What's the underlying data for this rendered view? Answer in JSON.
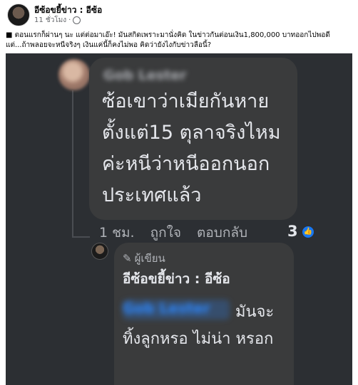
{
  "post": {
    "author": "อีซ้อขยี้ข่าว : อีซ้อ",
    "time": "11 ชั่วโมง",
    "audience_icon": "globe-icon",
    "text_line1": "■ ตอนแรกก็ผ่านๆ นะ แต่ต่อมาเอ๊ะ! มันสกิดเพราะมานั่งคิด ในข่าวกันต่อนเงิน1,800,000 บาทออกไปพอดี",
    "text_line2": "แต่...ถ้าพลอยจะหนีจริงๆ เงินแค่นี้ก็คงไม่พอ คิดว่ายังไงกับข่าวลือนี้?"
  },
  "screenshot": {
    "comment": {
      "author_blurred": "Gob Lester",
      "text": "ซ้อเขาว่าเมียกันหาย ตั้งแต่15 ตุลาจริงไหม ค่ะหนีว่าหนีออกนอก ประเทศแล้ว",
      "time": "1 ชม.",
      "like_label": "ถูกใจ",
      "reply_label": "ตอบกลับ",
      "reaction_count": "3",
      "reaction_icon": "like-icon"
    },
    "reply": {
      "author_badge": "ผู้เขียน",
      "author_badge_icon": "pencil-icon",
      "author": "อีซ้อขยี้ข่าว : อีซ้อ",
      "mention_blurred": "Gob Lester",
      "text_after_mention": "มันจะ",
      "text_rest": "ทิ้งลูกหรอ ไม่น่า หรอก"
    }
  },
  "colors": {
    "dark_bg": "#2c2f33",
    "bubble_bg": "#3a3b3c",
    "text_light": "#e4e6eb",
    "text_muted": "#b0b3b8",
    "accent_blue": "#1877f2"
  }
}
